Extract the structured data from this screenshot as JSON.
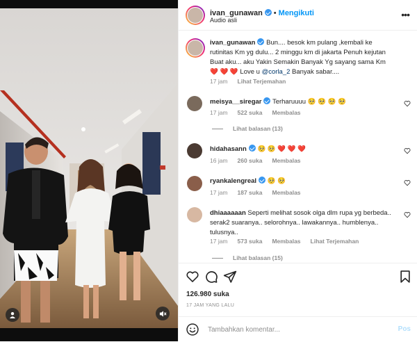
{
  "header": {
    "username": "ivan_gunawan",
    "follow_label": "Mengikuti",
    "audio_label": "Audio asli",
    "more_icon": "more-horizontal-icon"
  },
  "caption": {
    "username": "ivan_gunawan",
    "text": "Bun.... besok km pulang ,kembali ke rutinitas Km yg dulu... 2 minggu km di jakarta Penuh kejutan Buat aku... aku Yakin Semakin Banyak Yg sayang sama Km ❤️ ❤️ ❤️ Love u",
    "mention": "@corla_2",
    "text_after": "Banyak sabar....",
    "time": "17 jam",
    "translate": "Lihat Terjemahan"
  },
  "comments": [
    {
      "username": "meisya__siregar",
      "verified": true,
      "text": "Terharuuuu 🥺 🥺 🥺 🥺",
      "time": "17 jam",
      "likes": "522 suka",
      "reply": "Membalas",
      "view_replies": "Lihat balasan (13)"
    },
    {
      "username": "hidahasann",
      "verified": true,
      "text": "🥺 🥺 ❤️ ❤️ ❤️",
      "time": "16 jam",
      "likes": "260 suka",
      "reply": "Membalas"
    },
    {
      "username": "ryankalengreal",
      "verified": true,
      "text": "🥺 🥺",
      "time": "17 jam",
      "likes": "187 suka",
      "reply": "Membalas"
    },
    {
      "username": "dhiaaaaaan",
      "verified": false,
      "text": "Seperti melihat sosok olga dlm rupa yg berbeda.. serak2 suaranya.. selorohnya.. lawakannya.. humblenya.. tulusnya..",
      "time": "17 jam",
      "likes": "573 suka",
      "reply": "Membalas",
      "translate": "Lihat Terjemahan",
      "view_replies": "Lihat balasan (15)"
    }
  ],
  "actions": {
    "likes": "126.980 suka",
    "date": "17 JAM YANG LALU",
    "icons": [
      "heart-icon",
      "comment-icon",
      "share-icon",
      "bookmark-icon"
    ]
  },
  "composer": {
    "placeholder": "Tambahkan komentar...",
    "post_label": "Pos"
  },
  "colors": {
    "accent": "#0095f6",
    "heart": "#e0245e",
    "verified": "#3897f0",
    "muted": "#8e8e8e"
  }
}
